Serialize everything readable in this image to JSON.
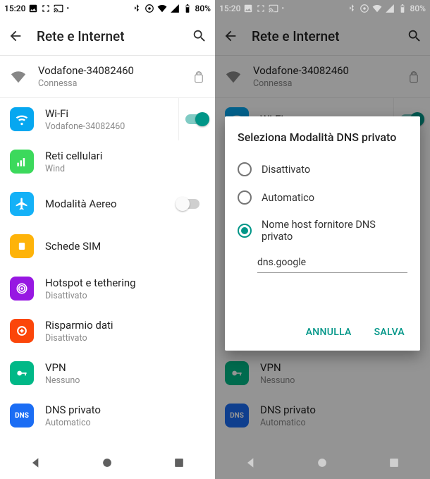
{
  "status": {
    "time": "15:20",
    "battery": "80%"
  },
  "header": {
    "title": "Rete e Internet"
  },
  "connection": {
    "ssid": "Vodafone-34082460",
    "state": "Connessa"
  },
  "items": {
    "wifi": {
      "title": "Wi-Fi",
      "sub": "Vodafone-34082460"
    },
    "cell": {
      "title": "Reti cellulari",
      "sub": "Wind"
    },
    "air": {
      "title": "Modalità Aereo"
    },
    "sim": {
      "title": "Schede SIM"
    },
    "hotspot": {
      "title": "Hotspot e tethering",
      "sub": "Disattivato"
    },
    "saver": {
      "title": "Risparmio dati",
      "sub": "Disattivato"
    },
    "vpn": {
      "title": "VPN",
      "sub": "Nessuno"
    },
    "dns": {
      "title": "DNS privato",
      "sub": "Automatico",
      "badge": "DNS"
    }
  },
  "dialog": {
    "title": "Seleziona Modalità DNS privato",
    "options": {
      "off": "Disattivato",
      "auto": "Automatico",
      "host": "Nome host fornitore DNS privato"
    },
    "input_value": "dns.google",
    "cancel": "ANNULLA",
    "save": "SALVA"
  }
}
